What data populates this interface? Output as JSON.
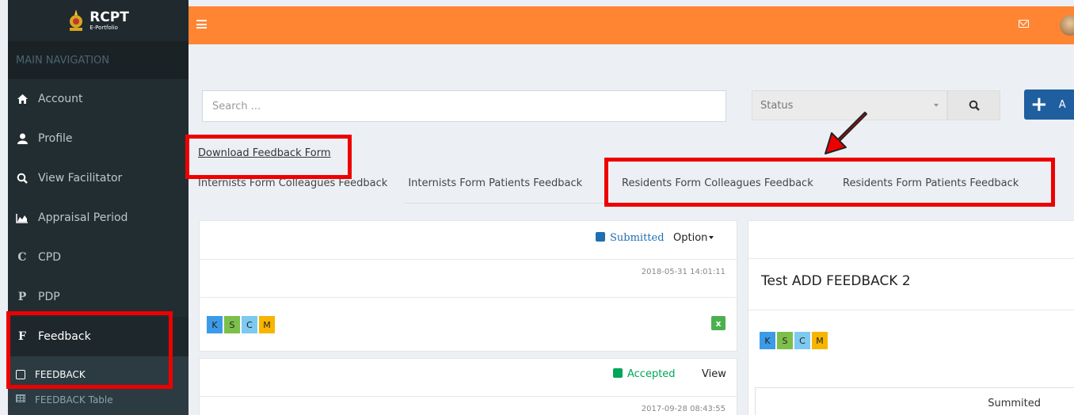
{
  "app": {
    "logo_title": "RCPT",
    "logo_sub": "E-Portfolio"
  },
  "sidebar": {
    "header": "MAIN NAVIGATION",
    "items": [
      {
        "label": "Account",
        "icon": "home-icon"
      },
      {
        "label": "Profile",
        "icon": "user-icon"
      },
      {
        "label": "View Facilitator",
        "icon": "search-icon"
      },
      {
        "label": "Appraisal Period",
        "icon": "area-chart-icon"
      },
      {
        "label": "CPD",
        "icon": "c-letter-icon"
      },
      {
        "label": "PDP",
        "icon": "p-letter-icon"
      },
      {
        "label": "Feedback",
        "icon": "f-letter-icon"
      }
    ],
    "sub_items": [
      {
        "label": "FEEDBACK",
        "icon": "checkbox-icon"
      },
      {
        "label": "FEEDBACK Table",
        "icon": "table-icon"
      }
    ]
  },
  "search": {
    "placeholder": "Search ..."
  },
  "status_select": {
    "value": "Status"
  },
  "add_button": {
    "label": "A"
  },
  "download_link": "Download Feedback Form",
  "tabs": [
    "Internists Form Colleagues Feedback",
    "Internists Form Patients Feedback",
    "Residents Form Colleagues Feedback",
    "Residents Form Patients Feedback"
  ],
  "cards": [
    {
      "status": "Submitted",
      "status_color": "#1f6fb2",
      "action": "Option",
      "datetime": "2018-05-31 14:01:11",
      "tags": [
        "K",
        "S",
        "C",
        "M"
      ]
    },
    {
      "status": "Accepted",
      "status_color": "#00a65a",
      "action": "View",
      "datetime": "2017-09-28 08:43:55"
    }
  ],
  "detail_card": {
    "title": "Test ADD FEEDBACK 2",
    "tags": [
      "K",
      "S",
      "C",
      "M"
    ],
    "summary_label": "Summited"
  },
  "tag_colors": {
    "K": "#3c9be8",
    "S": "#7cbf4b",
    "C": "#7dc9f0",
    "M": "#f7b500"
  },
  "colors": {
    "topbar": "#ff8533",
    "sidebar": "#222d32",
    "annotation": "#ee0000"
  }
}
